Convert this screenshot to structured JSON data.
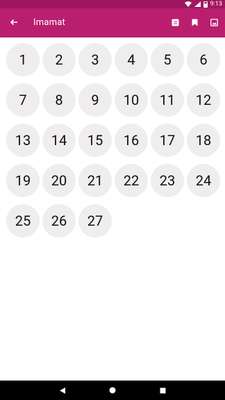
{
  "status_bar": {
    "time": "9:13",
    "icons": [
      "wifi-icon",
      "signal-icon",
      "battery-icon"
    ]
  },
  "app_bar": {
    "title": "Imamat",
    "back_icon": "arrow-left-icon",
    "actions": [
      "list-icon",
      "bookmark-icon",
      "image-icon"
    ],
    "background": "#b91f6e"
  },
  "items": [
    "1",
    "2",
    "3",
    "4",
    "5",
    "6",
    "7",
    "8",
    "9",
    "10",
    "11",
    "12",
    "13",
    "14",
    "15",
    "16",
    "17",
    "18",
    "19",
    "20",
    "21",
    "22",
    "23",
    "24",
    "25",
    "26",
    "27"
  ],
  "nav_bar": {
    "icons": [
      "back-triangle-icon",
      "home-circle-icon",
      "recents-square-icon"
    ]
  }
}
